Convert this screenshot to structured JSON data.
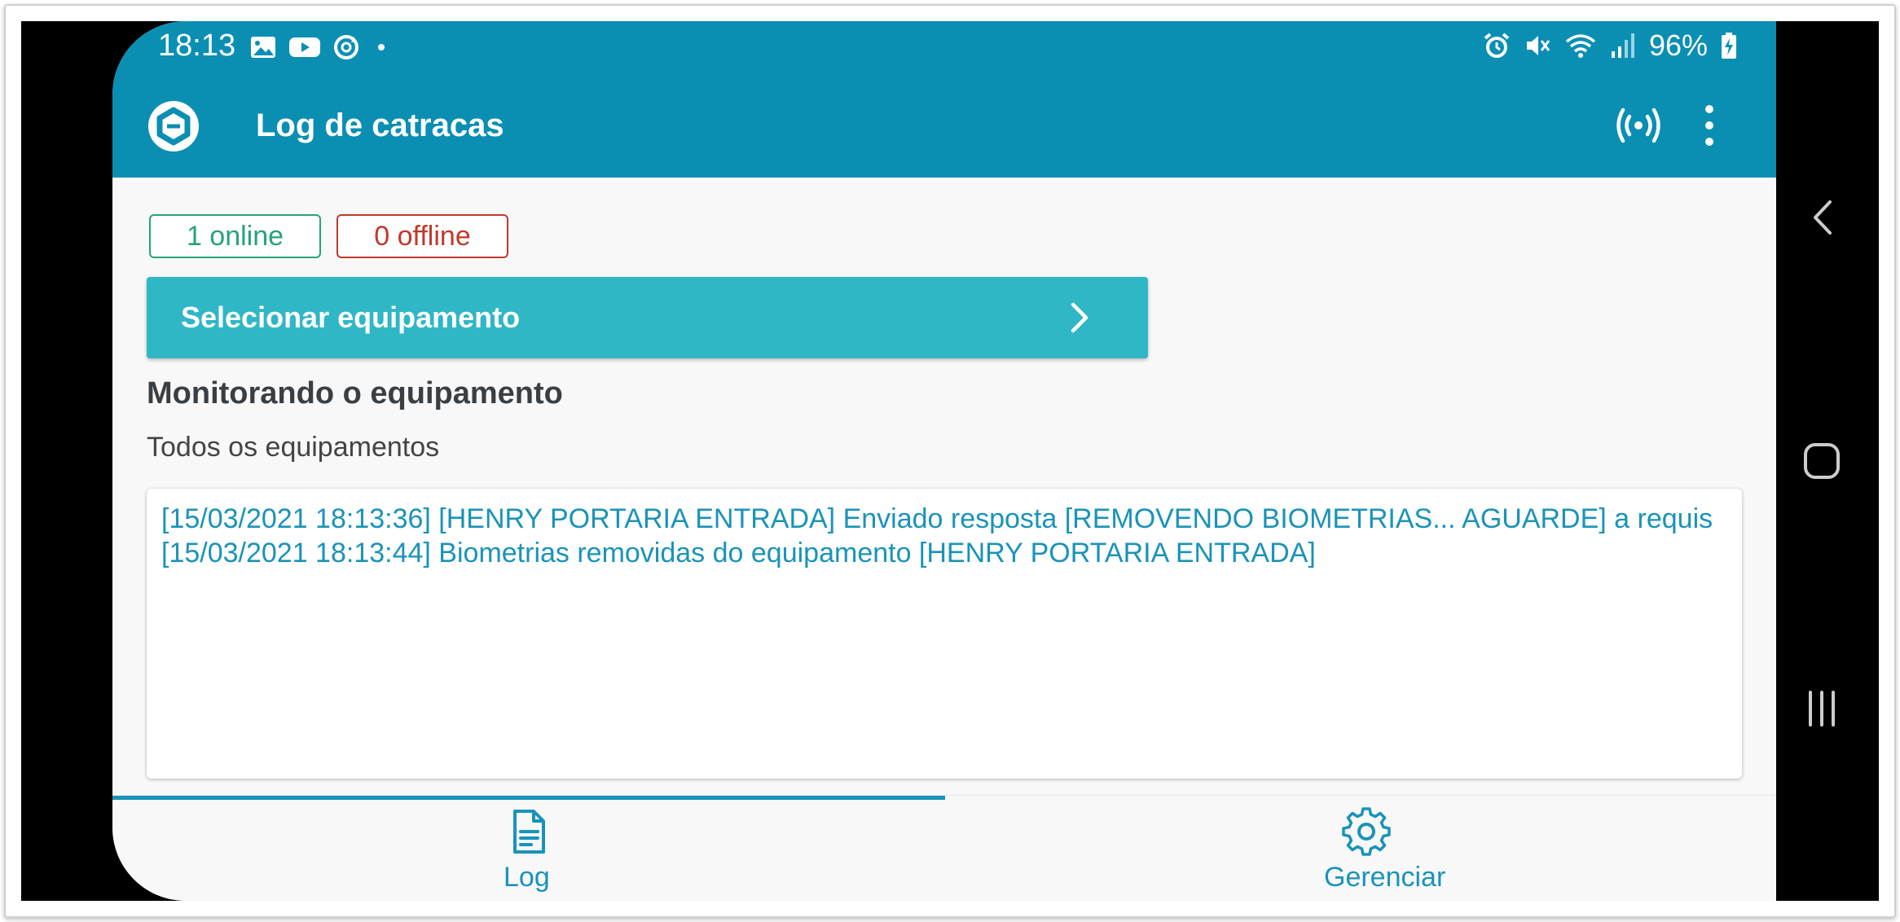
{
  "status_bar": {
    "time": "18:13",
    "left_icons": [
      "image-icon",
      "youtube-icon",
      "sync-icon",
      "dot-icon"
    ],
    "right_icons": [
      "alarm-icon",
      "mute-icon",
      "wifi-icon",
      "signal-icon",
      "battery-charging-icon"
    ],
    "battery": "96%"
  },
  "app_bar": {
    "title": "Log de catracas",
    "logo_icon": "app-logo-icon",
    "actions": [
      "broadcast-icon",
      "more-vert-icon"
    ],
    "color": "#0a8fb3"
  },
  "badges": {
    "online": "1 online",
    "offline": "0 offline",
    "online_color": "#26a37a",
    "offline_color": "#c0392b"
  },
  "select_button": {
    "label": "Selecionar equipamento",
    "color": "#2fb7c6"
  },
  "monitor": {
    "title": "Monitorando o equipamento",
    "subtitle": "Todos os equipamentos"
  },
  "log": {
    "lines": [
      "[15/03/2021 18:13:36] [HENRY PORTARIA ENTRADA] Enviado resposta [REMOVENDO BIOMETRIAS... AGUARDE] a requis",
      "[15/03/2021 18:13:44] Biometrias removidas do equipamento [HENRY PORTARIA ENTRADA]"
    ],
    "text_color": "#1a93b8"
  },
  "bottom_nav": {
    "items": [
      {
        "label": "Log",
        "icon": "document-icon",
        "active": true
      },
      {
        "label": "Gerenciar",
        "icon": "gear-icon",
        "active": false
      }
    ]
  },
  "system_nav": [
    "back-icon",
    "home-icon",
    "recents-icon"
  ]
}
